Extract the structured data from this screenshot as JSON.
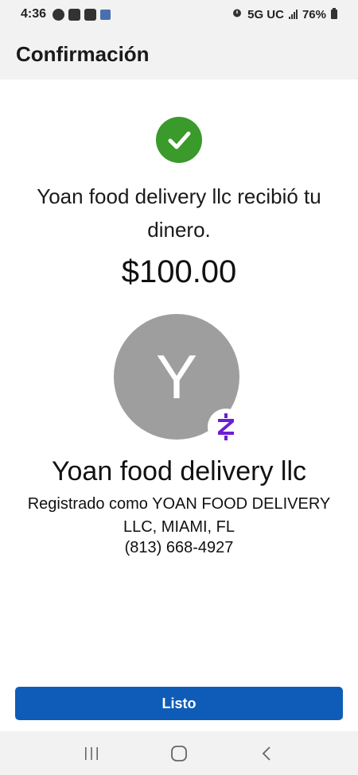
{
  "status_bar": {
    "time": "4:36",
    "network": "5G UC",
    "battery": "76%"
  },
  "header": {
    "title": "Confirmación"
  },
  "confirmation": {
    "message": "Yoan food delivery llc recibió tu dinero.",
    "amount": "$100.00",
    "avatar_initial": "Y",
    "badge_glyph": "Z",
    "recipient_name": "Yoan food delivery llc",
    "registered_as": "Registrado como YOAN FOOD DELIVERY LLC, MIAMI, FL",
    "phone": "(813) 668-4927"
  },
  "actions": {
    "done_label": "Listo"
  },
  "colors": {
    "success": "#3a9a2b",
    "primary": "#0f5cb8",
    "zelle": "#6d1ed4",
    "avatar": "#9e9e9e"
  },
  "icons": {
    "success": "check-circle-icon",
    "badge": "zelle-logo-icon"
  }
}
